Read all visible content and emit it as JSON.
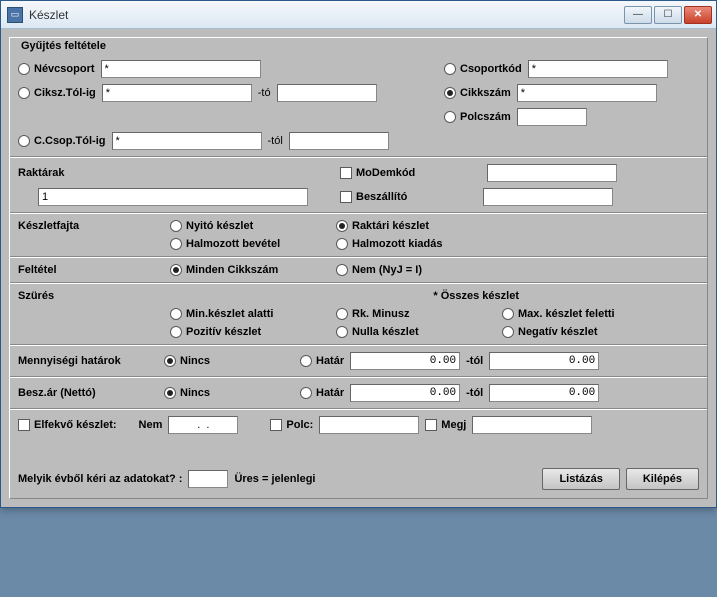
{
  "window": {
    "title": "Készlet"
  },
  "groupbox_title": "Gyűjtés feltétele",
  "gather": {
    "nevcsoport_label": "Névcsoport",
    "nevcsoport_value": "*",
    "csoportkod_label": "Csoportkód",
    "csoportkod_value": "*",
    "ciksz_label": "Ciksz.Tól-ig",
    "ciksz_from": "*",
    "ciksz_to_label": "-tó",
    "ciksz_to": "",
    "cikkszam_label": "Cikkszám",
    "cikkszam_value": "*",
    "polcszam_label": "Polcszám",
    "polcszam_value": "",
    "ccsop_label": "C.Csop.Tól-ig",
    "ccsop_from": "*",
    "ccsop_to_label": "-tól",
    "ccsop_to": ""
  },
  "raktarak": {
    "label": "Raktárak",
    "value": "1",
    "modemkod_label": "MoDemkód",
    "modemkod_value": "",
    "beszallito_label": "Beszállító",
    "beszallito_value": ""
  },
  "keszletfajta": {
    "label": "Készletfajta",
    "nyito": "Nyitó készlet",
    "raktari": "Raktári készlet",
    "halm_bev": "Halmozott bevétel",
    "halm_kiad": "Halmozott kiadás"
  },
  "feltetel": {
    "label": "Feltétel",
    "minden": "Minden Cikkszám",
    "nem": "Nem (NyJ = I)"
  },
  "szures": {
    "label": "Szürés",
    "osszes": "* Összes készlet",
    "min": "Min.készlet alatti",
    "rk": "Rk. Minusz",
    "max": "Max. készlet feletti",
    "pozitiv": "Pozitív készlet",
    "nulla": "Nulla készlet",
    "negativ": "Negatív készlet"
  },
  "menny": {
    "label": "Mennyiségi határok",
    "nincs": "Nincs",
    "hatar": "Határ",
    "val1": "0.00",
    "tol": "-tól",
    "val2": "0.00"
  },
  "besz": {
    "label": "Besz.ár (Nettó)",
    "nincs": "Nincs",
    "hatar": "Határ",
    "val1": "0.00",
    "tol": "-tól",
    "val2": "0.00"
  },
  "elfekvo": {
    "label": "Elfekvő készlet:",
    "nem": "Nem",
    "date": ".  .",
    "polc": "Polc:",
    "polc_val": "",
    "megj": "Megj",
    "megj_val": ""
  },
  "bottom": {
    "question": "Melyik évből kéri az adatokat? :",
    "year": "",
    "ures": "Üres = jelenlegi",
    "listazas": "Listázás",
    "kilepes": "Kilépés"
  }
}
